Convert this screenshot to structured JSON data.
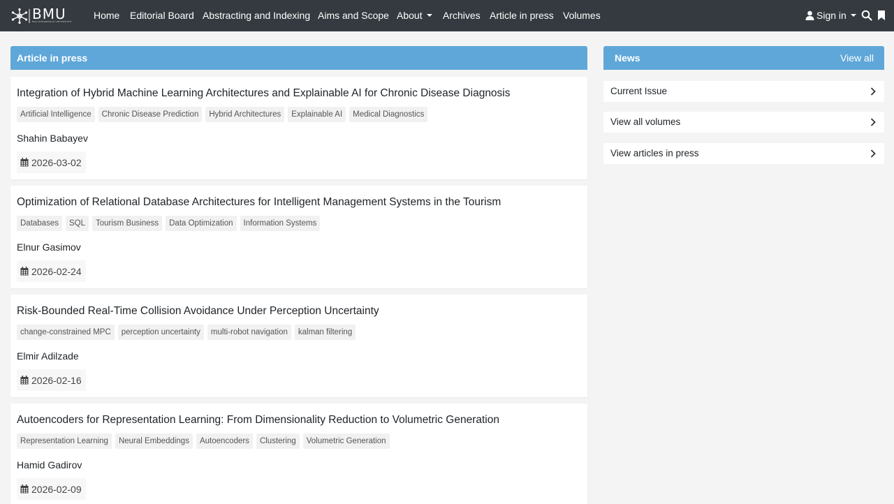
{
  "nav": {
    "logo_text": "BMU",
    "logo_subtitle": "BAKI MÜHƏNDİSLİK UNİVERSİTETİ",
    "items": [
      "Home",
      "Editorial Board",
      "Abstracting and Indexing",
      "Aims and Scope",
      "About",
      "Archives",
      "Article in press",
      "Volumes"
    ],
    "sign_in": "Sign in"
  },
  "main": {
    "header": "Article in press",
    "articles": [
      {
        "title": "Integration of Hybrid Machine Learning Architectures and Explainable AI for Chronic Disease Diagnosis",
        "tags": [
          "Artificial Intelligence",
          "Chronic Disease Prediction",
          "Hybrid Architectures",
          "Explainable AI",
          "Medical Diagnostics"
        ],
        "author": "Shahin Babayev",
        "date": "2026-03-02"
      },
      {
        "title": "Optimization of Relational Database Architectures for Intelligent Management Systems in the Tourism",
        "tags": [
          "Databases",
          "SQL",
          "Tourism Business",
          "Data Optimization",
          "Information Systems"
        ],
        "author": "Elnur Gasimov",
        "date": "2026-02-24"
      },
      {
        "title": "Risk-Bounded Real-Time Collision Avoidance Under Perception Uncertainty",
        "tags": [
          "change-constrained MPC",
          "perception uncertainty",
          "multi-robot navigation",
          "kalman filtering"
        ],
        "author": "Elmir Adilzade",
        "date": "2026-02-16"
      },
      {
        "title": "Autoencoders for Representation Learning: From Dimensionality Reduction to Volumetric Generation",
        "tags": [
          "Representation Learning",
          "Neural Embeddings",
          "Autoencoders",
          "Clustering",
          "Volumetric Generation"
        ],
        "author": "Hamid Gadirov",
        "date": "2026-02-09"
      }
    ]
  },
  "news": {
    "header": "News",
    "view_all": "View all",
    "items": [
      "Current Issue",
      "View all volumes",
      "View articles in press"
    ]
  },
  "colors": {
    "navbar": "#343a40",
    "accent": "#5fa7d9",
    "background": "#f4f4f4"
  },
  "icons": [
    "user-icon",
    "search-icon",
    "bookmark-icon",
    "calendar-icon",
    "chevron-right-icon"
  ]
}
